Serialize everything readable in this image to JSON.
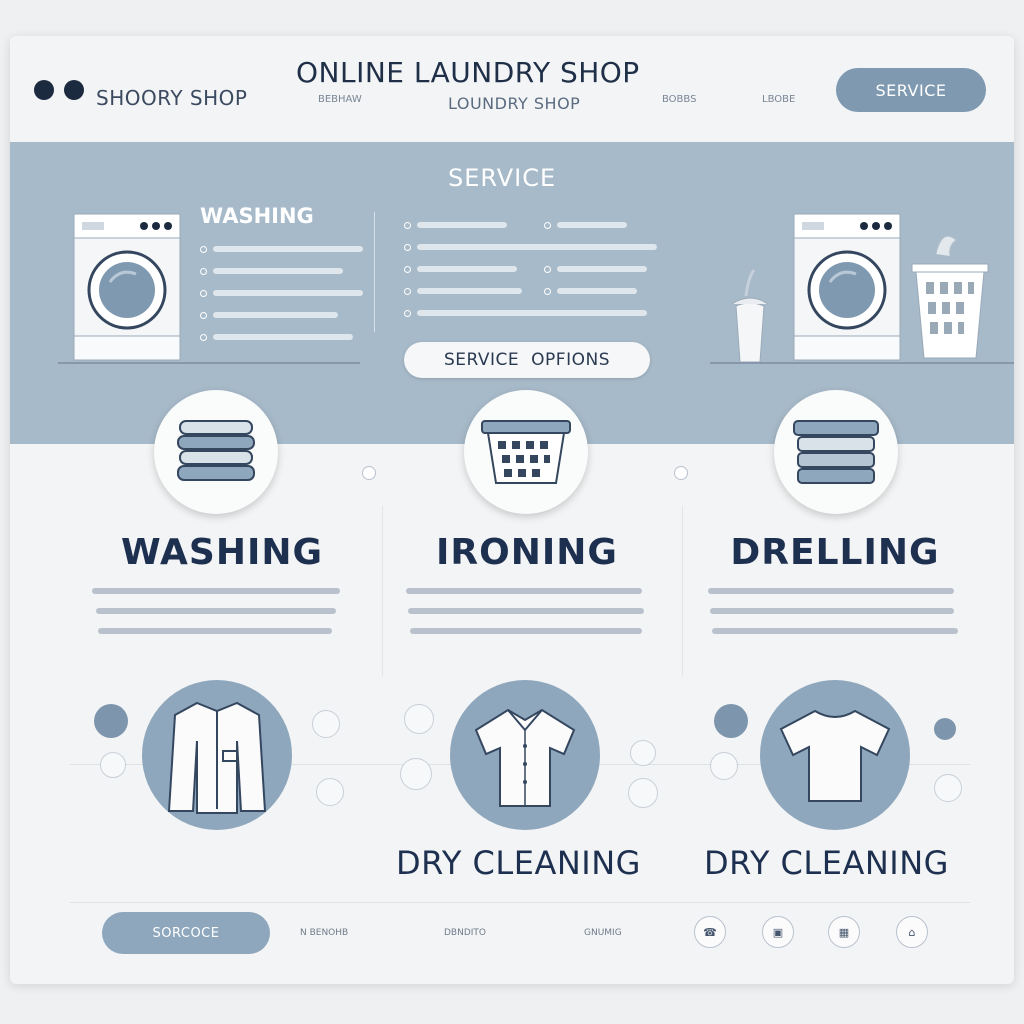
{
  "header": {
    "brand": "SHOORY SHOP",
    "site_title": "ONLINE LAUNDRY SHOP",
    "sub_title": "LOUNDRY SHOP",
    "nav": [
      "BEBHAW",
      "BOBBS",
      "LBOBE"
    ],
    "service_button": "SERVICE"
  },
  "band": {
    "title": "SERVICE",
    "washing_label": "WASHING",
    "options_pill": [
      "SERVICE",
      "OPFIONS"
    ]
  },
  "services": [
    {
      "title": "WASHING",
      "icon": "folded-towels-icon"
    },
    {
      "title": "IRONING",
      "icon": "laundry-basket-icon"
    },
    {
      "title": "DRELLING",
      "icon": "stacked-clothes-icon"
    }
  ],
  "dry_cleaning": [
    "DRY CLEANING",
    "DRY CLEANING"
  ],
  "footer": {
    "button": "SORCOCE",
    "links": [
      "N BENOHB",
      "DBNDITO",
      "GNUMIG"
    ],
    "icons": [
      "phone-icon",
      "bag-icon",
      "calendar-icon",
      "home-icon"
    ]
  },
  "colors": {
    "accent": "#7f99b1",
    "band": "#a7bac9",
    "dark": "#1c2a40"
  }
}
